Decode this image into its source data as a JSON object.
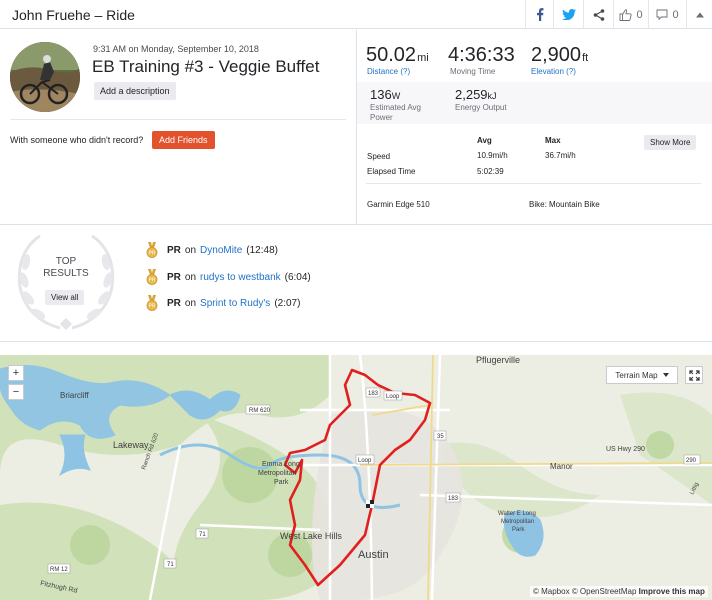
{
  "header": {
    "title": "John Fruehe – Ride",
    "kudos_count": "0",
    "comment_count": "0"
  },
  "activity": {
    "date": "9:31 AM on Monday, September 10, 2018",
    "name": "EB Training #3 - Veggie Buffet",
    "add_description": "Add a description",
    "with_someone": "With someone who didn't record?",
    "add_friends": "Add Friends"
  },
  "stats": {
    "distance": {
      "value": "50.02",
      "unit": "mi",
      "label": "Distance (?)"
    },
    "moving_time": {
      "value": "4:36:33",
      "label": "Moving Time"
    },
    "elevation": {
      "value": "2,900",
      "unit": "ft",
      "label": "Elevation (?)"
    },
    "power": {
      "value": "136",
      "unit": "W",
      "label1": "Estimated Avg",
      "label2": "Power"
    },
    "energy": {
      "value": "2,259",
      "unit": "kJ",
      "label": "Energy Output"
    },
    "table": {
      "col_avg": "Avg",
      "col_max": "Max",
      "speed_label": "Speed",
      "speed_avg": "10.9mi/h",
      "speed_max": "36.7mi/h",
      "elapsed_label": "Elapsed Time",
      "elapsed_avg": "5:02:39"
    },
    "show_more": "Show More",
    "device": "Garmin Edge 510",
    "bike": "Bike: Mountain Bike"
  },
  "top_results": {
    "title_line1": "TOP",
    "title_line2": "RESULTS",
    "view_all": "View all",
    "items": [
      {
        "pr": "PR",
        "on": "on",
        "segment": "DynoMite",
        "time": "(12:48)"
      },
      {
        "pr": "PR",
        "on": "on",
        "segment": "rudys to westbank",
        "time": "(6:04)"
      },
      {
        "pr": "PR",
        "on": "on",
        "segment": "Sprint to Rudy's",
        "time": "(2:07)"
      }
    ]
  },
  "map": {
    "zoom_in": "+",
    "zoom_out": "−",
    "map_type": "Terrain Map",
    "attribution_mapbox": "© Mapbox",
    "attribution_osm": "© OpenStreetMap",
    "improve": "Improve this map",
    "labels": {
      "pflugerville": "Pflugerville",
      "briarcliff": "Briarcliff",
      "lakeway": "Lakeway",
      "emma_long": "Emma Long",
      "emma_long2": "Metropolitan",
      "emma_long3": "Park",
      "west_lake": "West Lake Hills",
      "austin": "Austin",
      "manor": "Manor",
      "walter1": "Walter E Long",
      "walter2": "Metropolitan",
      "walter3": "Park",
      "us290": "US Hwy 290",
      "fitzhugh": "Fitzhugh Rd",
      "rm620": "RM 620",
      "ranch620": "Ranch Rd 620",
      "loop1": "Loop",
      "loop2": "Loop",
      "rm12": "RM 12",
      "r183": "183",
      "r35": "35",
      "r71a": "71",
      "r71b": "71",
      "r290": "290",
      "r183b": "183",
      "littig": "Littig"
    }
  },
  "colors": {
    "accent": "#fc4c02",
    "link": "#1f72c7",
    "route": "#e0201e",
    "button_orange": "#e2532d"
  }
}
